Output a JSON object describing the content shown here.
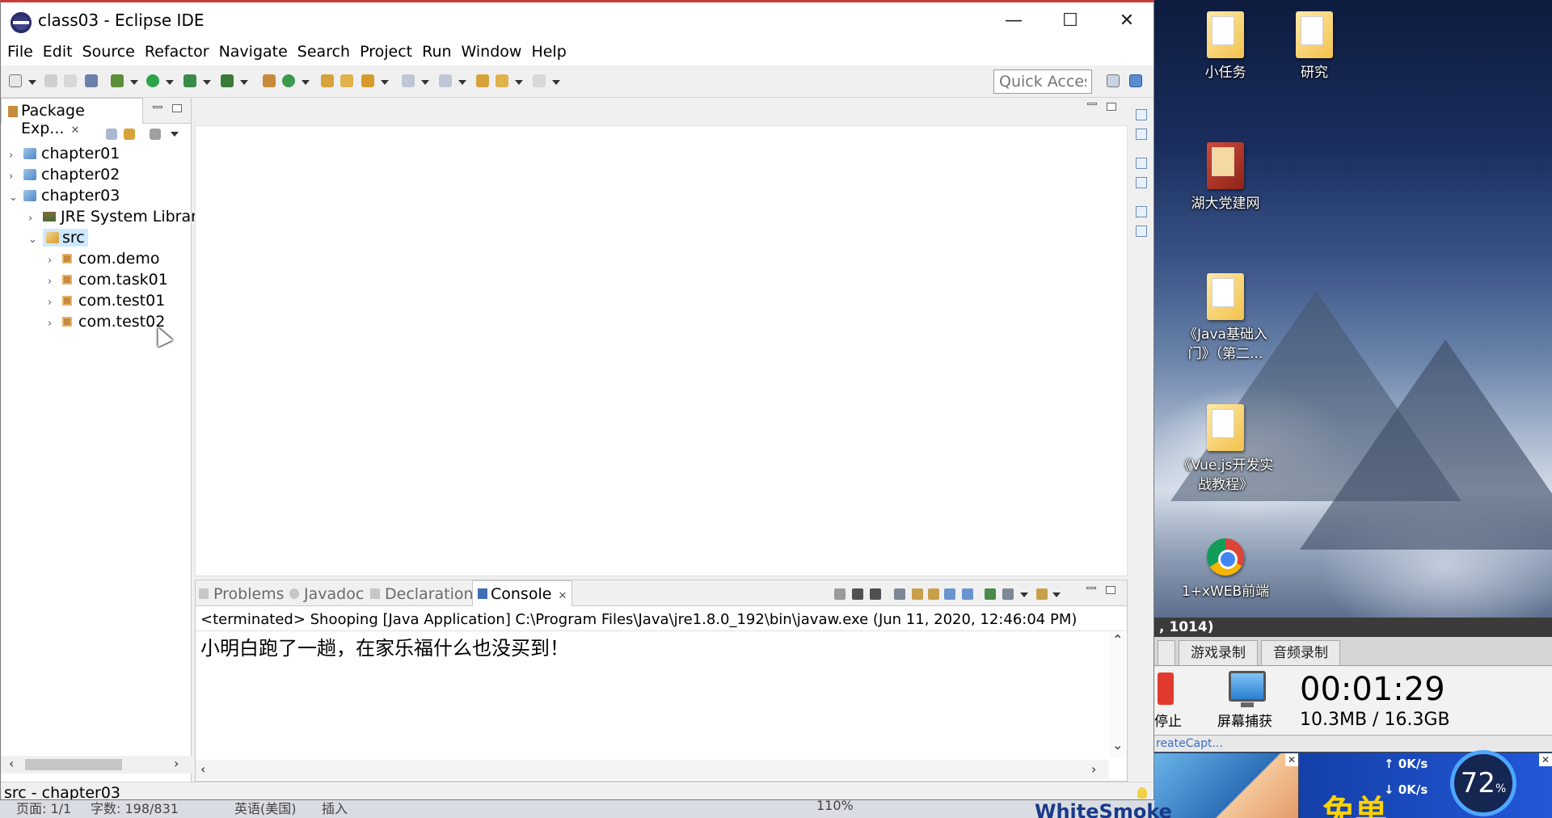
{
  "window": {
    "title": "class03 - Eclipse IDE",
    "minimize": "—",
    "maximize": "☐",
    "close": "✕"
  },
  "menu": [
    "File",
    "Edit",
    "Source",
    "Refactor",
    "Navigate",
    "Search",
    "Project",
    "Run",
    "Window",
    "Help"
  ],
  "toolbar": {
    "quick_access_placeholder": "Quick Access"
  },
  "package_explorer": {
    "tab_label": "Package Exp...",
    "close": "✕",
    "tree": [
      {
        "label": "chapter01",
        "twisty": "›"
      },
      {
        "label": "chapter02",
        "twisty": "›"
      },
      {
        "label": "chapter03",
        "twisty": "⌄"
      },
      {
        "label": "JRE System Library",
        "twisty": "›"
      },
      {
        "label": "src",
        "twisty": "⌄"
      },
      {
        "label": "com.demo",
        "twisty": "›"
      },
      {
        "label": "com.task01",
        "twisty": "›"
      },
      {
        "label": "com.test01",
        "twisty": "›"
      },
      {
        "label": "com.test02",
        "twisty": "›"
      }
    ],
    "scroll_left": "‹",
    "scroll_right": "›"
  },
  "bottom_panel": {
    "tabs": {
      "problems": "Problems",
      "javadoc": "Javadoc",
      "declaration": "Declaration",
      "console": "Console",
      "console_close": "✕"
    },
    "status": "<terminated> Shooping [Java Application] C:\\Program Files\\Java\\jre1.8.0_192\\bin\\javaw.exe (Jun 11, 2020, 12:46:04 PM)",
    "output": "小明白跑了一趟，在家乐福什么也没买到！"
  },
  "statusbar": {
    "text": "src - chapter03"
  },
  "desktop": {
    "icons": [
      {
        "label": "小任务"
      },
      {
        "label": "研究"
      },
      {
        "label": "湖大党建网"
      },
      {
        "label": "《Java基础入门》（第二..."
      },
      {
        "label": "《Vue.js开发实战教程》"
      },
      {
        "label": "1+xWEB前端"
      }
    ]
  },
  "recorder": {
    "header": ", 1014)",
    "tabs": [
      "游戏录制",
      "音频录制"
    ],
    "stop_label": "停止",
    "capture_label": "屏幕捕获",
    "time": "00:01:29",
    "size": "10.3MB / 16.3GB",
    "footer": "reateCapt..."
  },
  "ads": {
    "right_text": "免单"
  },
  "net_widget": {
    "up": "0K/s",
    "down": "0K/s",
    "percent": "72",
    "percent_unit": "%"
  },
  "word_strip": {
    "page": "页面: 1/1",
    "words": "字数: 198/831",
    "lang": "英语(美国)",
    "insert": "插入",
    "zoom": "110%"
  },
  "whitesmoke": "WhiteSmoke"
}
